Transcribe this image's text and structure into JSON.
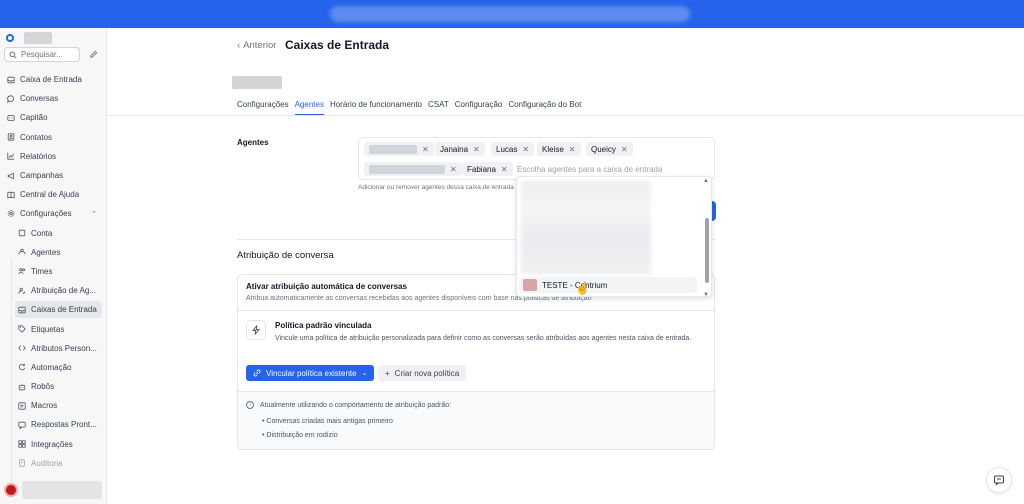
{
  "sidebar": {
    "search_placeholder": "Pesquisar...",
    "items": [
      {
        "label": "Caixa de Entrada",
        "icon": "inbox-icon"
      },
      {
        "label": "Conversas",
        "icon": "chat-icon"
      },
      {
        "label": "Capitão",
        "icon": "captain-icon"
      },
      {
        "label": "Contatos",
        "icon": "contacts-icon"
      },
      {
        "label": "Relatórios",
        "icon": "reports-icon"
      },
      {
        "label": "Campanhas",
        "icon": "megaphone-icon"
      },
      {
        "label": "Central de Ajuda",
        "icon": "book-icon"
      },
      {
        "label": "Configurações",
        "icon": "gear-icon"
      }
    ],
    "subitems": [
      {
        "label": "Conta",
        "icon": "account-icon"
      },
      {
        "label": "Agentes",
        "icon": "agents-icon"
      },
      {
        "label": "Times",
        "icon": "teams-icon"
      },
      {
        "label": "Atribuição de Ag...",
        "icon": "assignment-icon"
      },
      {
        "label": "Caixas de Entrada",
        "icon": "inbox-icon"
      },
      {
        "label": "Etiquetas",
        "icon": "tag-icon"
      },
      {
        "label": "Atributos Person...",
        "icon": "code-icon"
      },
      {
        "label": "Automação",
        "icon": "automation-icon"
      },
      {
        "label": "Robôs",
        "icon": "bot-icon"
      },
      {
        "label": "Macros",
        "icon": "macro-icon"
      },
      {
        "label": "Respostas Pront...",
        "icon": "canned-icon"
      },
      {
        "label": "Integrações",
        "icon": "integrations-icon"
      },
      {
        "label": "Auditoria",
        "icon": "audit-icon"
      }
    ]
  },
  "header": {
    "back_label": "Anterior",
    "title": "Caixas de Entrada"
  },
  "tabs": [
    "Configurações",
    "Agentes",
    "Horário de funcionamento",
    "CSAT",
    "Configuração",
    "Configuração do Bot"
  ],
  "agents": {
    "label": "Agentes",
    "chips": [
      "Janaina",
      "Lucas",
      "Kleise",
      "Queicy",
      "Fabiana"
    ],
    "placeholder": "Escolha agentes para a caixa de entrada",
    "helper": "Adicionar ou remover agentes dessa caixa de entrada"
  },
  "dropdown": {
    "highlighted_option": "TESTE - Centrium"
  },
  "assignment": {
    "section_title": "Atribuição de conversa",
    "auto_title": "Ativar atribuição automática de conversas",
    "auto_desc": "Atribua automaticamente as conversas recebidas aos agentes disponíveis com base nas políticas de atribuição",
    "policy_title": "Política padrão vinculada",
    "policy_desc": "Vincule uma política de atribuição personalizada para definir como as conversas serão atribuídas aos agentes nesta caixa de entrada.",
    "link_button": "Vincular política existente",
    "create_button": "Criar nova política",
    "info_text": "Atualmente utilizando o comportamento de atribuição padrão:",
    "bullets": [
      "Conversas criadas mais antigas primeiro",
      "Distribuição em rodízio"
    ]
  },
  "colors": {
    "primary": "#2563eb",
    "top_bar": "#2563eb",
    "sidebar_bg": "#f7f7f8"
  }
}
